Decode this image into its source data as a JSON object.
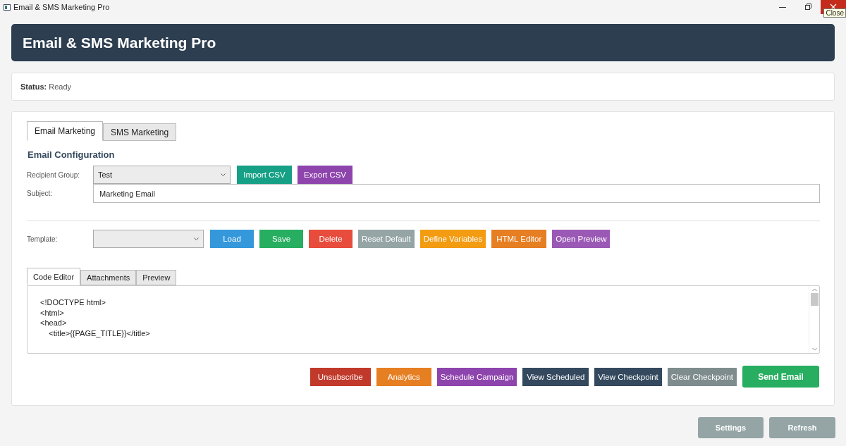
{
  "window": {
    "title": "Email & SMS Marketing Pro",
    "tooltip": "Close"
  },
  "header": {
    "title": "Email & SMS Marketing Pro"
  },
  "status": {
    "label": "Status:",
    "value": "Ready"
  },
  "tabs": [
    {
      "label": "Email Marketing",
      "selected": true
    },
    {
      "label": "SMS Marketing",
      "selected": false
    }
  ],
  "section_title": "Email Configuration",
  "recipient_group": {
    "label": "Recipient Group:",
    "value": "Test"
  },
  "recipient_buttons": [
    {
      "label": "Import CSV",
      "color": "#16a085"
    },
    {
      "label": "Export CSV",
      "color": "#8e44ad"
    }
  ],
  "subject": {
    "label": "Subject:",
    "value": "Marketing Email"
  },
  "template": {
    "label": "Template:"
  },
  "template_buttons": [
    {
      "label": "Load",
      "color": "#3498db"
    },
    {
      "label": "Save",
      "color": "#27ae60"
    },
    {
      "label": "Delete",
      "color": "#e74c3c"
    },
    {
      "label": "Reset Default",
      "color": "#95a5a6"
    },
    {
      "label": "Define Variables",
      "color": "#f39c12"
    },
    {
      "label": "HTML Editor",
      "color": "#e67e22"
    },
    {
      "label": "Open Preview",
      "color": "#9b59b6"
    }
  ],
  "editor_tabs": [
    {
      "label": "Code Editor",
      "selected": true
    },
    {
      "label": "Attachments",
      "selected": false
    },
    {
      "label": "Preview",
      "selected": false
    }
  ],
  "code_lines": [
    "<!DOCTYPE html>",
    "<html>",
    "<head>",
    "    <title>{{PAGE_TITLE}}</title>"
  ],
  "action_buttons": [
    {
      "label": "Unsubscribe",
      "color": "#c0392b",
      "kind": "flat"
    },
    {
      "label": "Analytics",
      "color": "#e67e22",
      "kind": "flat"
    },
    {
      "label": "Schedule Campaign",
      "color": "#8e44ad",
      "kind": "flat"
    },
    {
      "label": "View Scheduled",
      "color": "#34495e",
      "kind": "flat"
    },
    {
      "label": "View Checkpoint",
      "color": "#34495e",
      "kind": "flat"
    },
    {
      "label": "Clear Checkpoint",
      "color": "#7f8c8d",
      "kind": "flat"
    },
    {
      "label": "Send Email",
      "color": "#27ae60",
      "kind": "primary"
    }
  ],
  "footer_buttons": [
    {
      "label": "Settings",
      "color": "#95a5a6"
    },
    {
      "label": "Refresh",
      "color": "#95a5a6"
    }
  ]
}
